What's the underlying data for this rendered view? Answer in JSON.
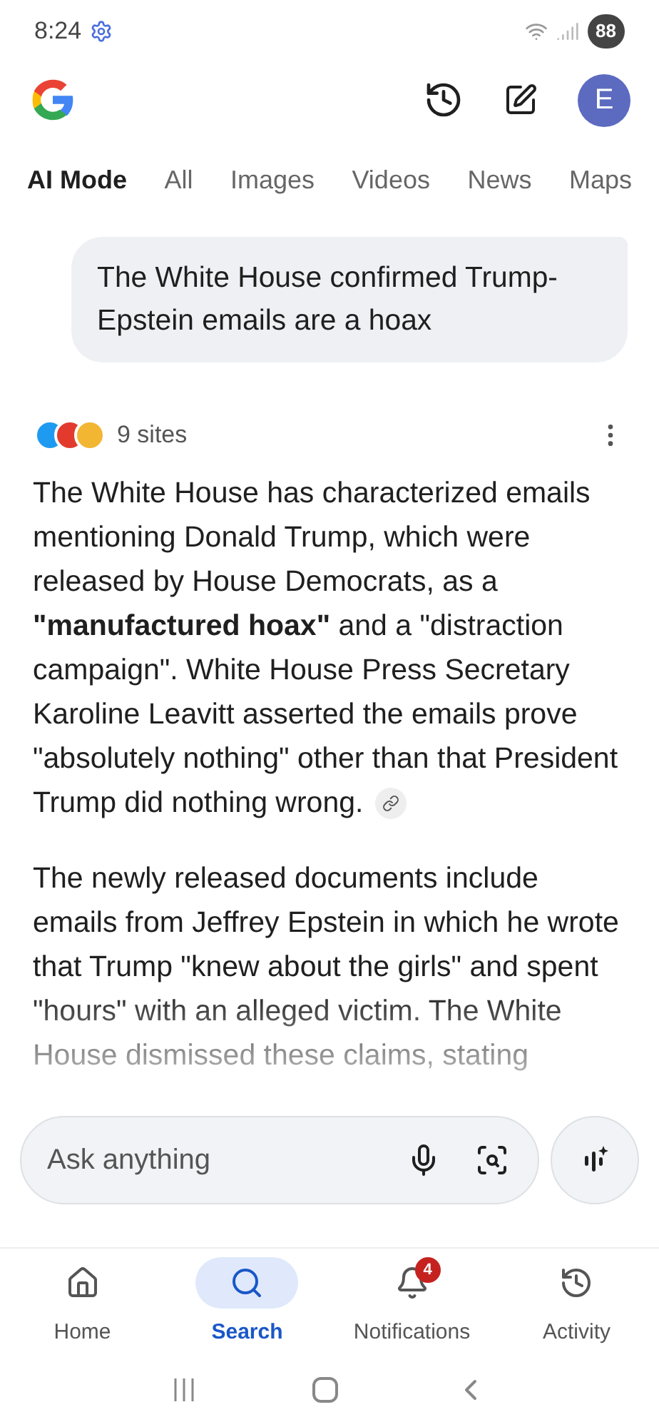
{
  "status_bar": {
    "time": "8:24",
    "battery": "88"
  },
  "header": {
    "avatar": "E"
  },
  "tabs": [
    {
      "label": "AI Mode",
      "selected": true
    },
    {
      "label": "All",
      "selected": false
    },
    {
      "label": "Images",
      "selected": false
    },
    {
      "label": "Videos",
      "selected": false
    },
    {
      "label": "News",
      "selected": false
    },
    {
      "label": "Maps",
      "selected": false
    }
  ],
  "query": "The White House confirmed Trump-Epstein emails are a hoax",
  "sources": {
    "count": "9 sites"
  },
  "answer": [
    "The White House has characterized emails mentioning Donald Trump, which were released by House Democrats, as a **\"manufactured hoax\"** and a \"distraction campaign\". White House Press Secretary Karoline Leavitt asserted the emails prove \"absolutely nothing\" other than that President Trump did nothing wrong.",
    "The newly released documents include emails from Jeffrey Epstein in which he wrote that Trump \"knew about the girls\" and spent \"hours\" with an alleged victim. The White House dismissed these claims, stating"
  ],
  "search": {
    "placeholder": "Ask anything"
  },
  "nav": [
    {
      "label": "Home",
      "selected": false
    },
    {
      "label": "Search",
      "selected": true
    },
    {
      "label": "Notifications",
      "selected": false,
      "badge": "4"
    },
    {
      "label": "Activity",
      "selected": false
    }
  ]
}
